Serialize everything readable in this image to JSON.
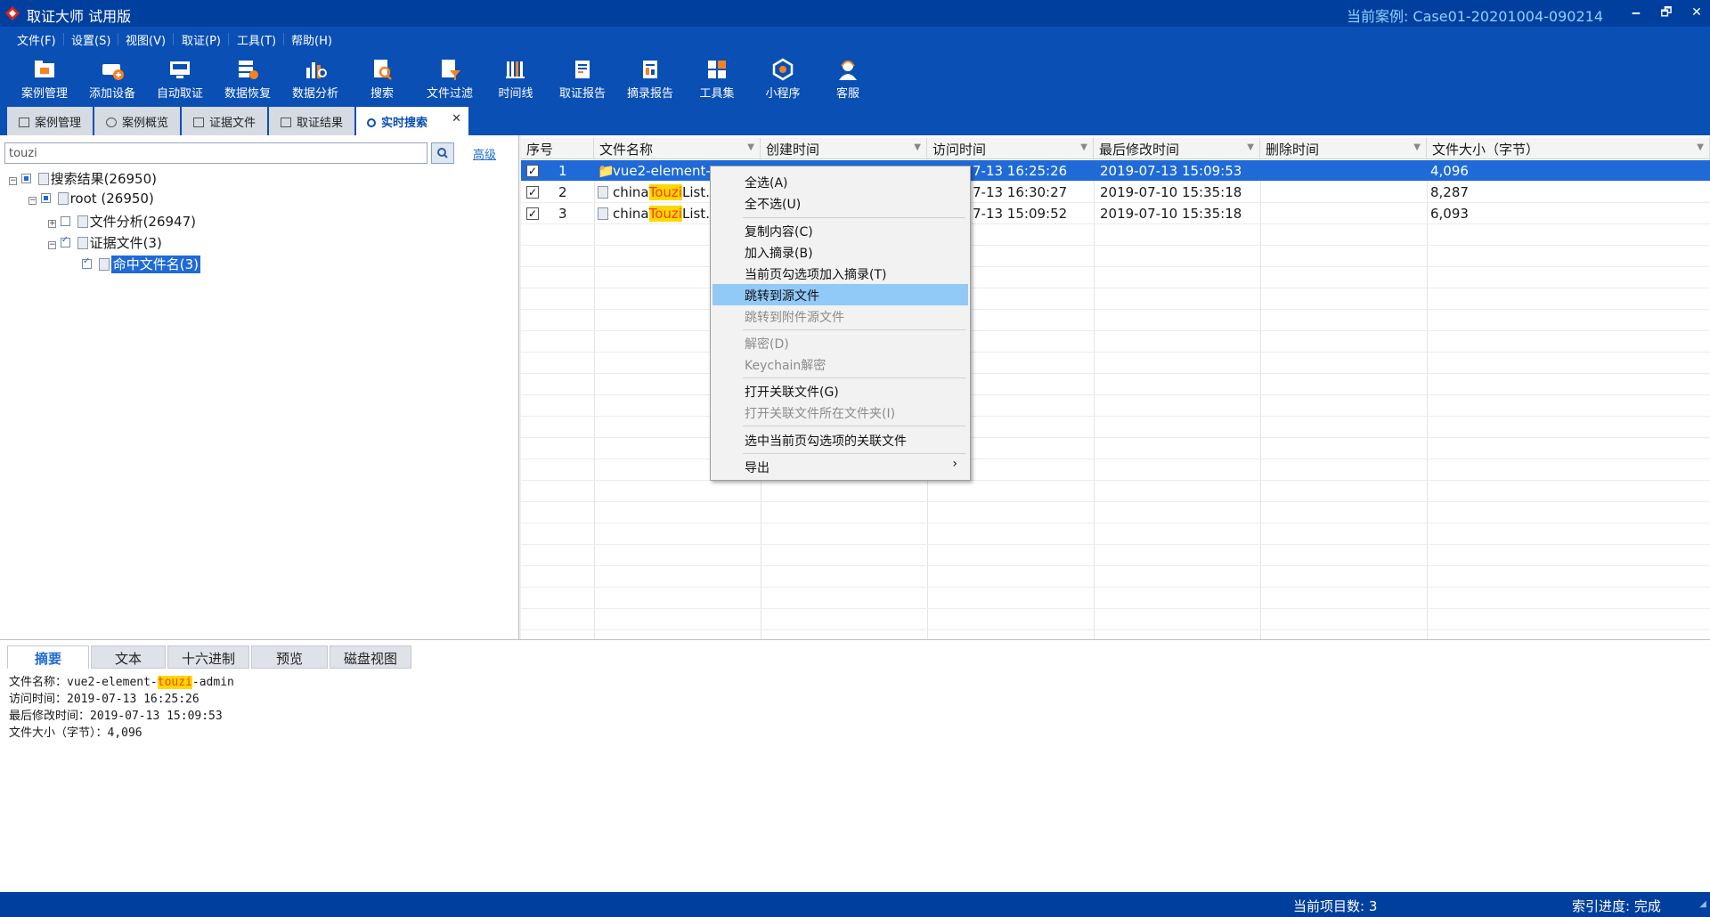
{
  "window": {
    "title": "取证大师 试用版",
    "current_case": "当前案例:   Case01-20201004-090214",
    "minimize": "🗕",
    "restore": "🗗",
    "close": "✕"
  },
  "menu": [
    "文件(F)",
    "设置(S)",
    "视图(V)",
    "取证(P)",
    "工具(T)",
    "帮助(H)"
  ],
  "toolbar": [
    {
      "label": "案例管理",
      "icon": "case-manage-icon"
    },
    {
      "label": "添加设备",
      "icon": "add-device-icon"
    },
    {
      "label": "自动取证",
      "icon": "auto-forensics-icon"
    },
    {
      "label": "数据恢复",
      "icon": "data-recovery-icon"
    },
    {
      "label": "数据分析",
      "icon": "data-analysis-icon"
    },
    {
      "label": "搜索",
      "icon": "search-doc-icon"
    },
    {
      "label": "文件过滤",
      "icon": "file-filter-icon"
    },
    {
      "label": "时间线",
      "icon": "timeline-icon"
    },
    {
      "label": "取证报告",
      "icon": "forensic-report-icon"
    },
    {
      "label": "摘录报告",
      "icon": "excerpt-report-icon"
    },
    {
      "label": "工具集",
      "icon": "toolset-icon"
    },
    {
      "label": "小程序",
      "icon": "mini-program-icon"
    },
    {
      "label": "客服",
      "icon": "customer-service-icon"
    }
  ],
  "tabs": [
    {
      "label": "案例管理",
      "active": false
    },
    {
      "label": "案例概览",
      "active": false
    },
    {
      "label": "证据文件",
      "active": false
    },
    {
      "label": "取证结果",
      "active": false
    },
    {
      "label": "实时搜索",
      "active": true
    }
  ],
  "tab_close": "✕",
  "search": {
    "value": "touzi",
    "advanced_label": "高级"
  },
  "tree": {
    "root_results": "搜索结果(26950)",
    "root": "root (26950)",
    "file_analysis": "文件分析(26947)",
    "evidence_files": "证据文件(3)",
    "hit_filename": "命中文件名(3)"
  },
  "grid": {
    "columns": [
      "序号",
      "文件名称",
      "创建时间",
      "访问时间",
      "最后修改时间",
      "删除时间",
      "文件大小（字节）"
    ],
    "rows": [
      {
        "no": "1",
        "name_prefix": "vue2-element-",
        "name_hl": "",
        "name_suffix": "",
        "created": "",
        "accessed": "7-13 16:25:26",
        "modified": "2019-07-13 15:09:53",
        "deleted": "",
        "size": "4,096",
        "selected": true
      },
      {
        "no": "2",
        "name_prefix": "china",
        "name_hl": "Touzi",
        "name_suffix": "List.",
        "created": "",
        "accessed": "7-13 16:30:27",
        "modified": "2019-07-10 15:35:18",
        "deleted": "",
        "size": "8,287",
        "selected": false
      },
      {
        "no": "3",
        "name_prefix": "china",
        "name_hl": "Touzi",
        "name_suffix": "List.",
        "created": "",
        "accessed": "7-13 15:09:52",
        "modified": "2019-07-10 15:35:18",
        "deleted": "",
        "size": "6,093",
        "selected": false
      }
    ]
  },
  "context_menu": {
    "items": [
      {
        "label": "全选(A)",
        "disabled": false
      },
      {
        "label": "全不选(U)",
        "disabled": false
      },
      {
        "label": "复制内容(C)",
        "disabled": false
      },
      {
        "label": "加入摘录(B)",
        "disabled": false
      },
      {
        "label": "当前页勾选项加入摘录(T)",
        "disabled": false
      },
      {
        "label": "跳转到源文件",
        "disabled": false,
        "hover": true
      },
      {
        "label": "跳转到附件源文件",
        "disabled": true
      },
      {
        "label": "解密(D)",
        "disabled": true
      },
      {
        "label": "Keychain解密",
        "disabled": true
      },
      {
        "label": "打开关联文件(G)",
        "disabled": false
      },
      {
        "label": "打开关联文件所在文件夹(I)",
        "disabled": true
      },
      {
        "label": "选中当前页勾选项的关联文件",
        "disabled": false
      },
      {
        "label": "导出",
        "disabled": false,
        "submenu": true
      }
    ],
    "submenu_arrow": "›"
  },
  "bottom_tabs": [
    {
      "label": "摘要",
      "active": true
    },
    {
      "label": "文本",
      "active": false
    },
    {
      "label": "十六进制",
      "active": false
    },
    {
      "label": "预览",
      "active": false
    },
    {
      "label": "磁盘视图",
      "active": false
    }
  ],
  "detail": {
    "name_label": "文件名称：vue2-element-",
    "name_hl": "touzi",
    "name_suffix": "-admin",
    "accessed": "访问时间：2019-07-13 16:25:26",
    "modified": "最后修改时间：2019-07-13 15:09:53",
    "size": "文件大小（字节）：4,096"
  },
  "status": {
    "item_count": "当前项目数: 3",
    "index_progress": "索引进度: 完成"
  },
  "colors": {
    "titlebar": "#003f9e",
    "toolbar": "#0a4fb4",
    "selection": "#1f6ad6",
    "highlight": "#ffd800",
    "menu_hover": "#91c9f7"
  }
}
